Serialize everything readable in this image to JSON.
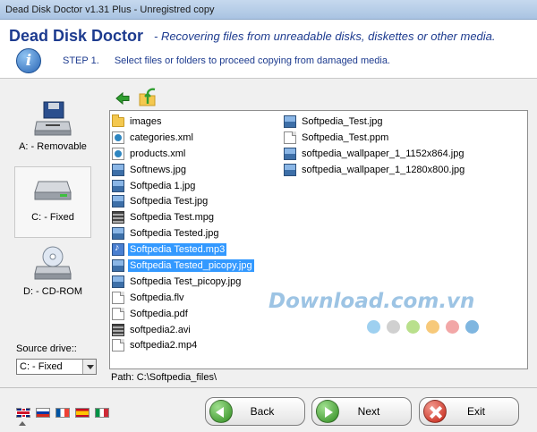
{
  "window": {
    "title": "Dead Disk Doctor v1.31 Plus - Unregistred copy"
  },
  "header": {
    "app_name": "Dead Disk Doctor",
    "tagline": "- Recovering files from unreadable disks, diskettes or other media.",
    "step_number": "STEP 1.",
    "step_text": "Select files or folders to proceed copying from damaged media."
  },
  "drives": [
    {
      "label": "A: - Removable",
      "icon": "floppy-drive-icon"
    },
    {
      "label": "C: - Fixed",
      "icon": "hard-drive-icon",
      "selected": true
    },
    {
      "label": "D: - CD-ROM",
      "icon": "cdrom-drive-icon"
    }
  ],
  "source_drive": {
    "label": "Source drive::",
    "value": "C: - Fixed"
  },
  "files": {
    "column1": [
      {
        "name": "images",
        "type": "folder"
      },
      {
        "name": "categories.xml",
        "type": "xml"
      },
      {
        "name": "products.xml",
        "type": "xml"
      },
      {
        "name": "Softnews.jpg",
        "type": "img"
      },
      {
        "name": "Softpedia 1.jpg",
        "type": "img"
      },
      {
        "name": "Softpedia Test.jpg",
        "type": "img"
      },
      {
        "name": "Softpedia Test.mpg",
        "type": "video"
      },
      {
        "name": "Softpedia Tested.jpg",
        "type": "img"
      },
      {
        "name": "Softpedia Tested.mp3",
        "type": "audio",
        "selected": true
      },
      {
        "name": "Softpedia Tested_picopy.jpg",
        "type": "img",
        "selected": true
      },
      {
        "name": "Softpedia Test_picopy.jpg",
        "type": "img"
      },
      {
        "name": "Softpedia.flv",
        "type": "doc"
      },
      {
        "name": "Softpedia.pdf",
        "type": "doc"
      },
      {
        "name": "softpedia2.avi",
        "type": "video"
      },
      {
        "name": "softpedia2.mp4",
        "type": "doc"
      }
    ],
    "column2": [
      {
        "name": "Softpedia_Test.jpg",
        "type": "img"
      },
      {
        "name": "Softpedia_Test.ppm",
        "type": "doc"
      },
      {
        "name": "softpedia_wallpaper_1_1152x864.jpg",
        "type": "img"
      },
      {
        "name": "softpedia_wallpaper_1_1280x800.jpg",
        "type": "img"
      }
    ]
  },
  "path_text": "Path: C:\\Softpedia_files\\",
  "watermark": {
    "text": "Download.com.vn",
    "dot_colors": [
      "#9ed0f0",
      "#d0d0d0",
      "#b9e08c",
      "#f7c97a",
      "#f2a7a7",
      "#7fb6e0"
    ]
  },
  "languages": [
    "flag-uk",
    "flag-ru",
    "flag-fr",
    "flag-es",
    "flag-it"
  ],
  "buttons": {
    "back": "Back",
    "next": "Next",
    "exit": "Exit"
  }
}
